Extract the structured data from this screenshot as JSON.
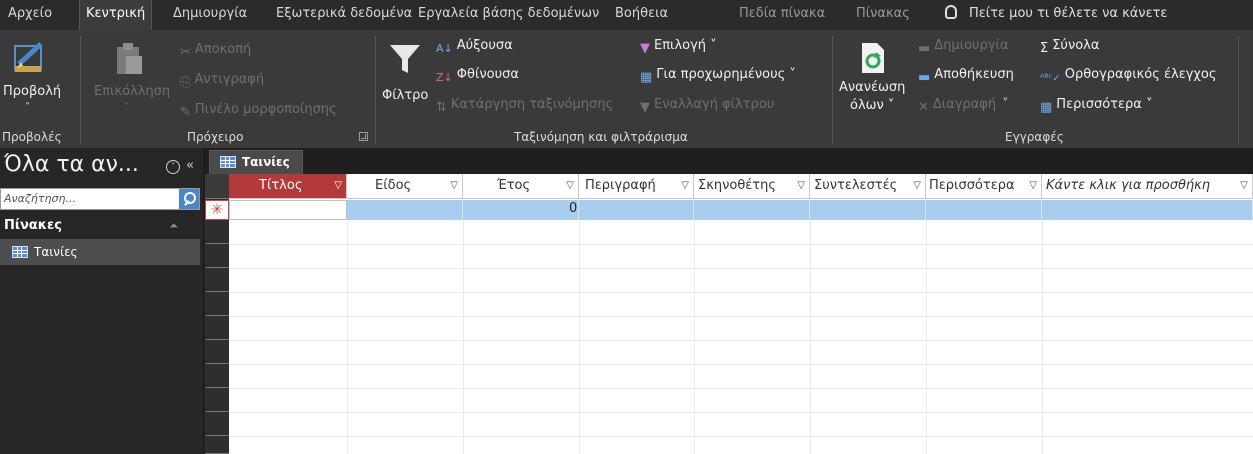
{
  "menu": {
    "file": "Αρχείο",
    "home": "Κεντρική",
    "create": "Δημιουργία",
    "external": "Εξωτερικά δεδομένα",
    "dbtools": "Εργαλεία βάσης δεδομένων",
    "help": "Βοήθεια",
    "fields": "Πεδία πίνακα",
    "table": "Πίνακας",
    "tellme": "Πείτε μου τι θέλετε να κάνετε"
  },
  "ribbon": {
    "views": {
      "view_label": "Προβολή",
      "group_label": "Προβολές"
    },
    "clipboard": {
      "paste_label": "Επικόλληση",
      "cut_label": "Αποκοπή",
      "copy_label": "Αντιγραφή",
      "format_painter_label": "Πινέλο μορφοποίησης",
      "group_label": "Πρόχειρο"
    },
    "sort_filter": {
      "filter_label": "Φίλτρο",
      "ascending_label": "Αύξουσα",
      "descending_label": "Φθίνουσα",
      "remove_sort_label": "Κατάργηση ταξινόμησης",
      "selection_label": "Επιλογή ˅",
      "advanced_label": "Για προχωρημένους ˅",
      "toggle_filter_label": "Εναλλαγή φίλτρου",
      "group_label": "Ταξινόμηση και φιλτράρισμα"
    },
    "records": {
      "refresh_label_1": "Ανανέωση",
      "refresh_label_2": "όλων ˅",
      "new_label": "Δημιουργία",
      "save_label": "Αποθήκευση",
      "delete_label": "Διαγραφή",
      "totals_label": "Σύνολα",
      "spelling_label": "Ορθογραφικός έλεγχος",
      "more_label": "Περισσότερα ˅",
      "group_label": "Εγγραφές"
    }
  },
  "nav": {
    "title": "Όλα τα αν...",
    "search_placeholder": "Αναζήτηση...",
    "group_label": "Πίνακες",
    "items": [
      {
        "label": "Ταινίες"
      }
    ]
  },
  "document": {
    "tab_label": "Ταινίες",
    "columns": [
      {
        "label": "Τίτλος"
      },
      {
        "label": "Είδος"
      },
      {
        "label": "Έτος"
      },
      {
        "label": "Περιγραφή"
      },
      {
        "label": "Σκηνοθέτης"
      },
      {
        "label": "Συντελεστές"
      },
      {
        "label": "Περισσότερα"
      },
      {
        "label": "Κάντε κλικ για προσθήκη"
      }
    ],
    "new_row": {
      "year_value": "0"
    },
    "new_record_marker": "✳"
  }
}
